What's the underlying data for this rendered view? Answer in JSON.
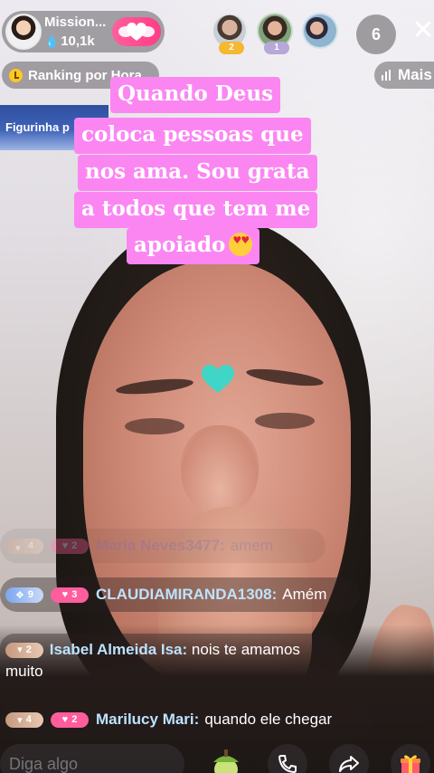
{
  "host": {
    "name": "Mission...",
    "likes": "10,1k"
  },
  "viewers": [
    {
      "badge": "2",
      "badge_color": "#f5b82e"
    },
    {
      "badge": "1",
      "badge_color": "#b7a8d8"
    }
  ],
  "viewer_count": "6",
  "ranking": {
    "label": "Ranking por Hora"
  },
  "more": {
    "label": "Mais"
  },
  "sticker_banner": {
    "label": "Figurinha p"
  },
  "caption": {
    "lines": [
      "Quando Deus",
      "coloca pessoas que",
      "nos ama. Sou grata",
      "a todos que tem me",
      "apoiado"
    ],
    "emoji": "heart-eyes-emoji"
  },
  "chat": [
    {
      "level1": "4",
      "level2": "2",
      "user": "Maria Neves3477:",
      "message": "amem"
    },
    {
      "level1": "9",
      "level2": "3",
      "user": "CLAUDIAMIRANDA1308:",
      "message": "Amém"
    },
    {
      "level1": "2",
      "user": "Isabel Almeida Isa:",
      "message": "nois te amamos muito"
    },
    {
      "level1": "4",
      "level2": "2",
      "user": "Marilucy Mari:",
      "message": "quando ele chegar"
    }
  ],
  "input": {
    "placeholder": "Diga algo"
  },
  "colors": {
    "caption_bg": "#fb86f2",
    "follow": "#ff4d90",
    "username": "#bde2ff"
  }
}
